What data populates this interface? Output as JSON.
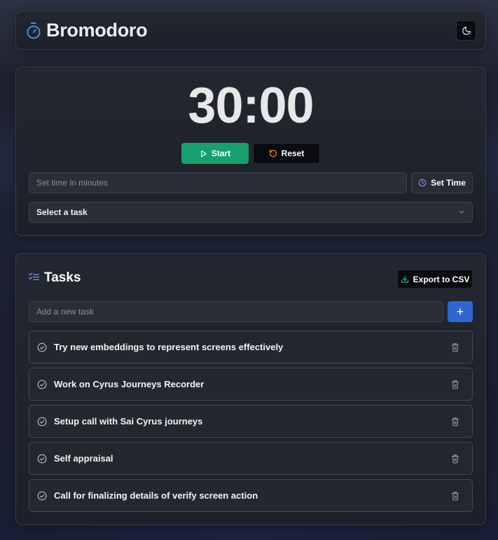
{
  "app": {
    "title": "Bromodoro"
  },
  "icons": {
    "logo": "stopwatch-icon",
    "theme": "moon-icon",
    "start": "play-icon",
    "reset": "rotate-ccw-icon",
    "set_time": "clock-icon",
    "select": "chevron-down-icon",
    "tasks": "list-checks-icon",
    "export": "download-icon",
    "add": "plus-icon",
    "task_check": "circle-check-icon",
    "task_delete": "trash-icon"
  },
  "colors": {
    "start": "#16a070",
    "add": "#2f66d0",
    "logo": "#3f8fe6",
    "reset_icon": "#f08a2c",
    "set_time_icon": "#a67be8",
    "export_icon": "#22b590",
    "tasks_icon": "#7a8ee8"
  },
  "timer": {
    "display": "30:00",
    "start_label": "Start",
    "reset_label": "Reset",
    "time_input_placeholder": "Set time in minutes",
    "set_time_label": "Set Time",
    "task_select_value": "Select a task"
  },
  "tasks": {
    "title": "Tasks",
    "export_label": "Export to CSV",
    "new_task_placeholder": "Add a new task",
    "add_label": "+",
    "items": [
      {
        "text": "Try new embeddings to represent screens effectively"
      },
      {
        "text": "Work on Cyrus Journeys Recorder"
      },
      {
        "text": "Setup call with Sai Cyrus journeys"
      },
      {
        "text": "Self appraisal"
      },
      {
        "text": "Call for finalizing details of verify screen action"
      }
    ]
  }
}
